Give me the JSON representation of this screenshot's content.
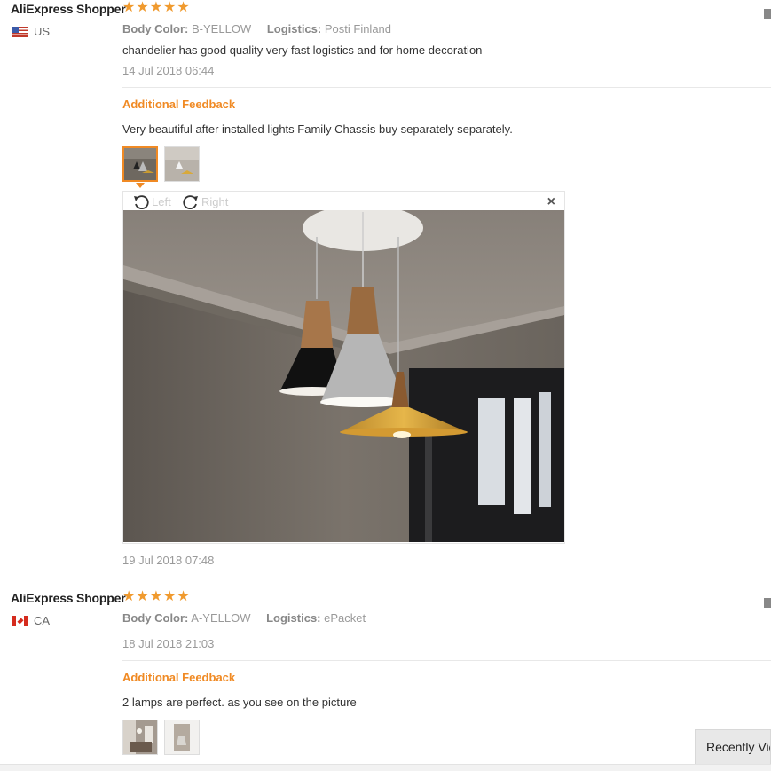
{
  "reviews": [
    {
      "user": "AliExpress Shopper",
      "country": "US",
      "rating": 5,
      "color_label": "Body Color:",
      "color_value": "B-YELLOW",
      "logistics_label": "Logistics:",
      "logistics_value": "Posti Finland",
      "text": "chandelier has good quality very fast logistics and for home decoration",
      "date": "14 Jul 2018 06:44",
      "additional_label": "Additional Feedback",
      "additional_text": "Very beautiful after installed lights Family Chassis buy separately separately.",
      "additional_date": "19 Jul 2018 07:48",
      "viewer": {
        "left_label": "Left",
        "right_label": "Right",
        "close": "×"
      }
    },
    {
      "user": "AliExpress Shopper",
      "country": "CA",
      "rating": 5,
      "color_label": "Body Color:",
      "color_value": "A-YELLOW",
      "logistics_label": "Logistics:",
      "logistics_value": "ePacket",
      "date": "18 Jul 2018 21:03",
      "additional_label": "Additional Feedback",
      "additional_text": "2 lamps are perfect. as you see on the picture"
    }
  ],
  "star_glyph": "★",
  "recently_viewed": "Recently Viewed",
  "colors": {
    "accent": "#f08a24",
    "star": "#f09a2e"
  }
}
